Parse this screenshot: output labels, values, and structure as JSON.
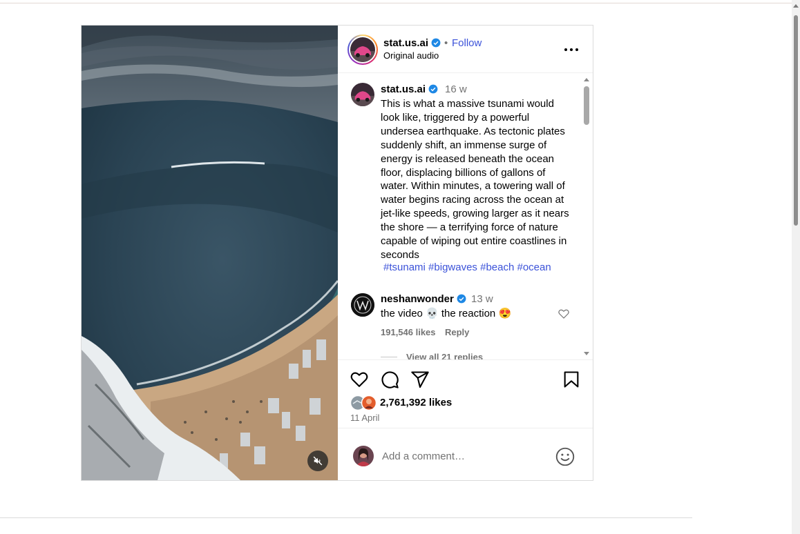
{
  "post": {
    "username": "stat.us.ai",
    "follow_label": "Follow",
    "separator": "•",
    "audio": "Original audio",
    "more_icon": "more-options-icon",
    "verified_color": "#1e88e5"
  },
  "caption": {
    "username": "stat.us.ai",
    "time": "16 w",
    "text": "This is what a massive tsunami would look like, triggered by a powerful undersea earthquake. As tectonic plates suddenly shift, an immense surge of energy is released beneath the ocean floor, displacing billions of gallons of water. Within minutes, a towering wall of water begins racing across the ocean at jet-like speeds, growing larger as it nears the shore — a terrifying force of nature capable of wiping out entire coastlines in seconds",
    "hashtags": [
      "#tsunami",
      "#bigwaves",
      "#beach",
      "#ocean"
    ]
  },
  "comment": {
    "username": "neshanwonder",
    "time": "13 w",
    "text": "the video 💀 the reaction 😍",
    "likes": "191,546 likes",
    "reply_label": "Reply",
    "view_replies": "View all 21 replies"
  },
  "stats": {
    "likes": "2,761,392 likes",
    "date": "11 April"
  },
  "comment_box": {
    "placeholder": "Add a comment…"
  },
  "colors": {
    "link_blue": "#3b52d9",
    "muted_text": "#737373",
    "border": "#dbdbdb"
  }
}
